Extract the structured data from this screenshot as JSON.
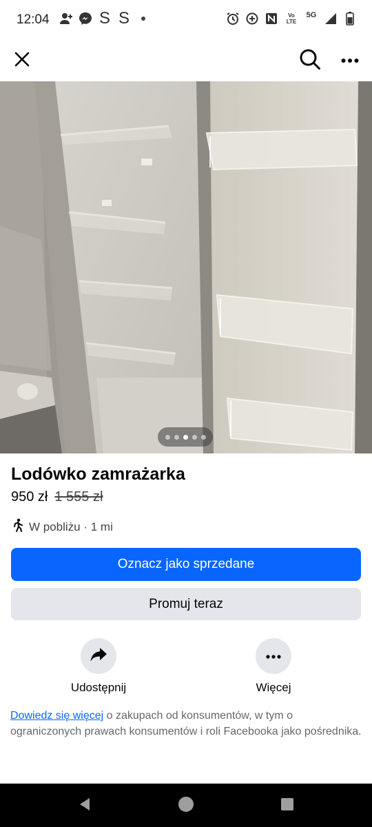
{
  "status_bar": {
    "time": "12:04",
    "left_icons": [
      "person-add-icon",
      "messenger-icon",
      "s-app-icon",
      "s-app-icon",
      "dot-icon"
    ],
    "s_letter": "S",
    "network": "5G",
    "volte": "Vo LTE",
    "right_icons": [
      "alarm-icon",
      "data-saver-icon",
      "nfc-icon",
      "volte-icon",
      "5g-icon",
      "signal-icon",
      "battery-icon"
    ]
  },
  "toolbar": {
    "close_icon": "close-icon",
    "search_icon": "search-icon",
    "more_icon": "more-icon"
  },
  "gallery": {
    "image_count": 5,
    "active_index": 2
  },
  "listing": {
    "title": "Lodówko zamrażarka",
    "price": "950 zł",
    "old_price": "1 555 zł",
    "location": "W pobliżu · 1 mi"
  },
  "buttons": {
    "mark_sold": "Oznacz jako sprzedane",
    "promote": "Promuj teraz"
  },
  "actions": {
    "share": "Udostępnij",
    "more": "Więcej"
  },
  "info": {
    "link": "Dowiedz się więcej",
    "text": " o zakupach od konsumentów, w tym o ograniczonych prawach konsumentów i roli Facebooka jako pośrednika."
  },
  "colors": {
    "primary": "#0866ff",
    "secondary_bg": "#e4e6eb",
    "text": "#050505",
    "muted": "#65676b"
  }
}
